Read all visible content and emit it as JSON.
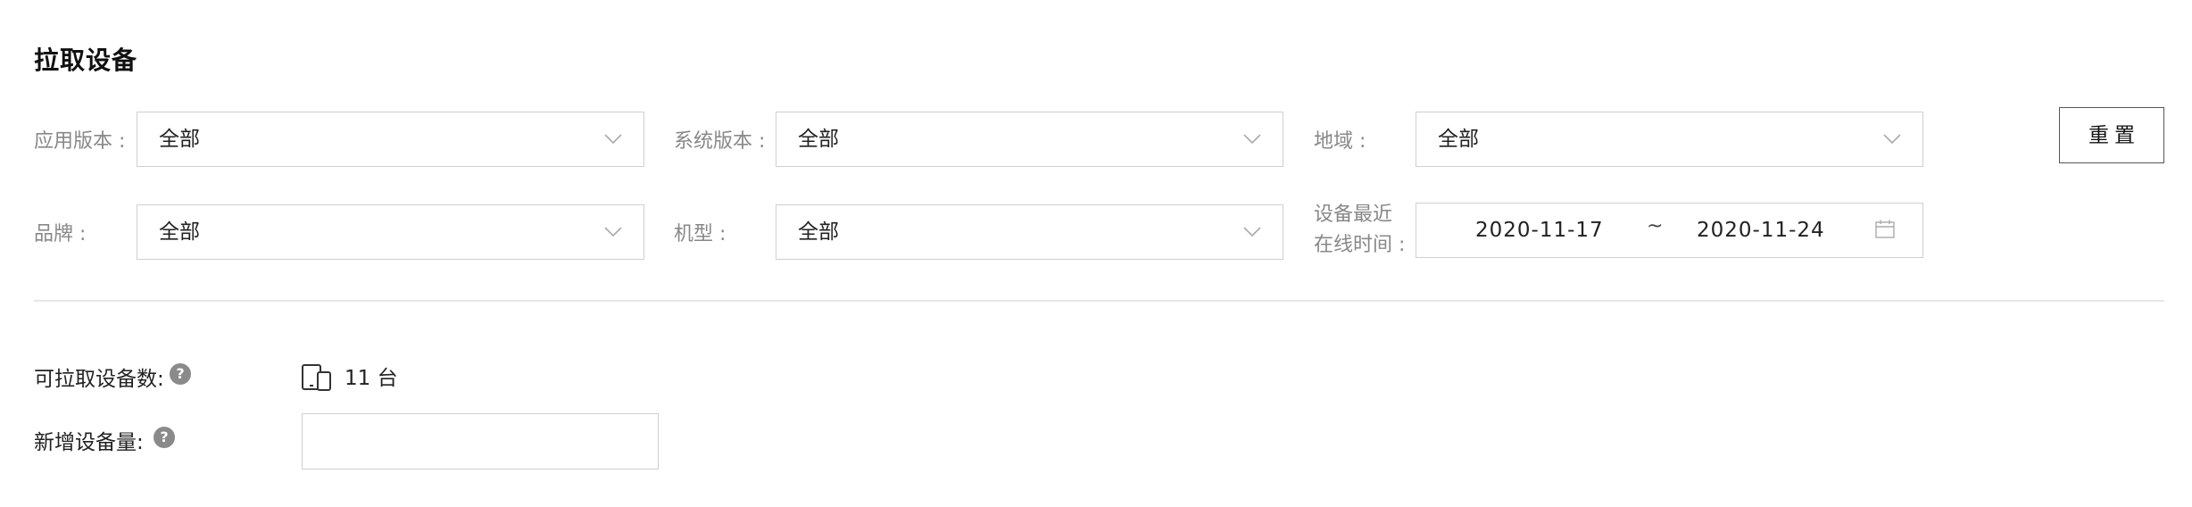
{
  "section": {
    "title": "拉取设备"
  },
  "filters": {
    "app_version": {
      "label": "应用版本 :",
      "value": "全部"
    },
    "system_version": {
      "label": "系统版本 :",
      "value": "全部"
    },
    "region": {
      "label": "地域 :",
      "value": "全部"
    },
    "brand": {
      "label": "品牌 :",
      "value": "全部"
    },
    "model": {
      "label": "机型 :",
      "value": "全部"
    },
    "last_online": {
      "label_line1": "设备最近",
      "label_line2": "在线时间 :",
      "start": "2020-11-17",
      "separator": "~",
      "end": "2020-11-24"
    }
  },
  "actions": {
    "reset_label": "重置"
  },
  "stats": {
    "available_label": "可拉取设备数:",
    "available_count": "11 台",
    "new_devices_label": "新增设备量:",
    "new_devices_value": "",
    "help_glyph": "?"
  },
  "icons": {
    "chevron": "chevron-down-icon",
    "calendar": "calendar-icon",
    "devices": "devices-icon",
    "help": "question-circle-icon"
  },
  "colors": {
    "label_gray": "#888888",
    "border_gray": "#cfcfcf",
    "help_icon_bg": "#8a8a8a",
    "divider": "#e6e6e6"
  }
}
